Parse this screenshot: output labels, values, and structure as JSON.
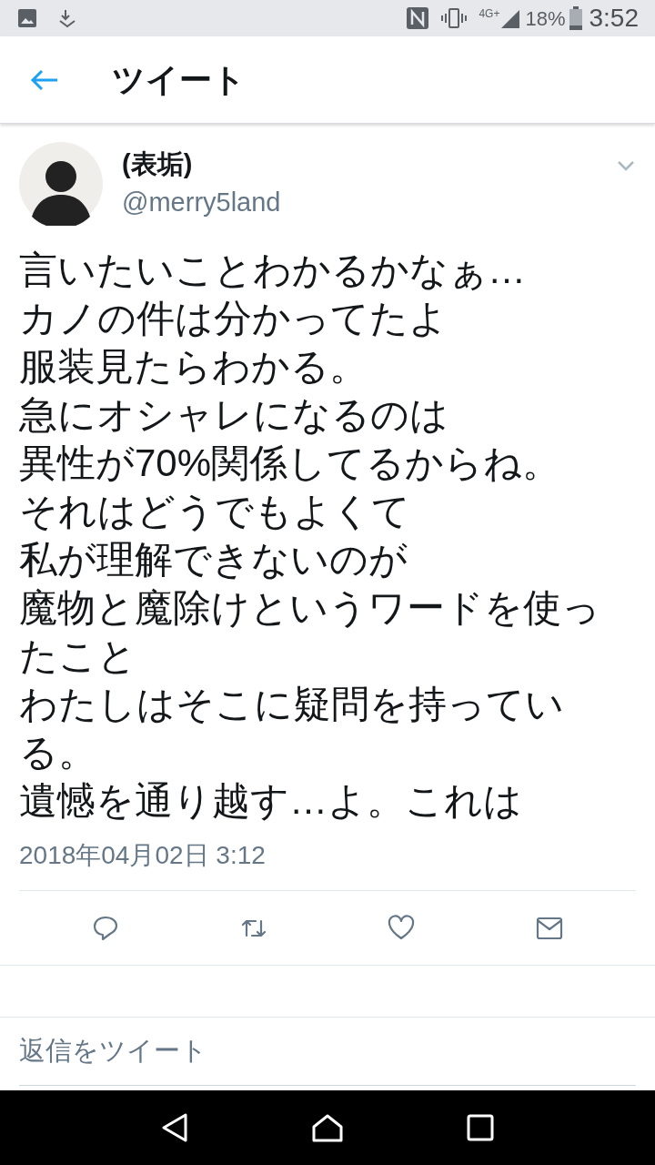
{
  "status_bar": {
    "network": "4G+",
    "battery": "18%",
    "time": "3:52"
  },
  "header": {
    "title": "ツイート"
  },
  "tweet": {
    "name": "(表垢)",
    "handle": "@merry5land",
    "lines": [
      "言いたいことわかるかなぁ…",
      "カノの件は分かってたよ",
      "服装見たらわかる。",
      "急にオシャレになるのは",
      "異性が70%関係してるからね。",
      "それはどうでもよくて",
      "私が理解できないのが",
      "魔物と魔除けというワードを使ったこと",
      "わたしはそこに疑問を持っている。",
      "遺憾を通り越す…よ。これは"
    ],
    "timestamp": "2018年04月02日 3:12",
    "actions": [
      {
        "kind": "reply"
      },
      {
        "kind": "retweet"
      },
      {
        "kind": "like"
      },
      {
        "kind": "message"
      }
    ]
  },
  "reply": {
    "placeholder": "返信をツイート"
  }
}
